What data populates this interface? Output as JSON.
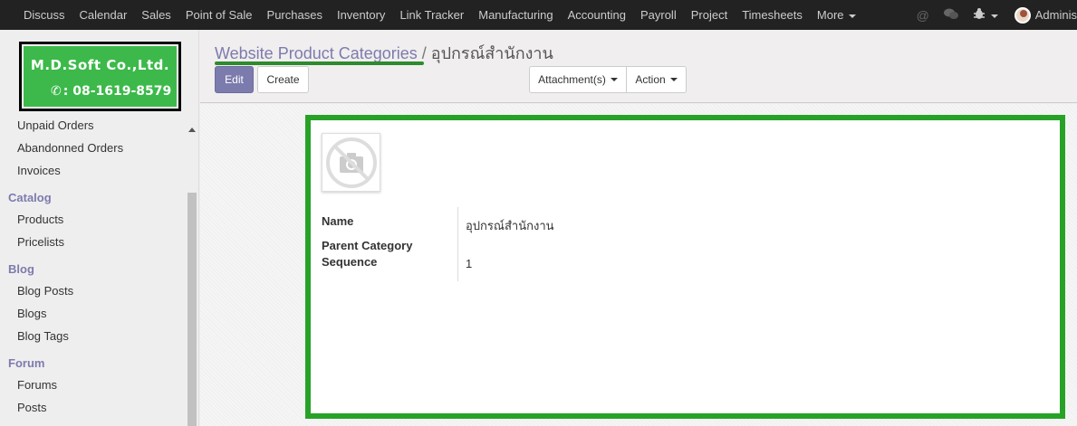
{
  "topbar": {
    "menu": [
      "Discuss",
      "Calendar",
      "Sales",
      "Point of Sale",
      "Purchases",
      "Inventory",
      "Link Tracker",
      "Manufacturing",
      "Accounting",
      "Payroll",
      "Project",
      "Timesheets"
    ],
    "more_label": "More",
    "user_name": "Adminis",
    "icons": [
      "at-icon",
      "chat-icon",
      "bug-icon"
    ]
  },
  "logo": {
    "company": "M.D.Soft Co.,Ltd.",
    "phone": ": 08-1619-8579"
  },
  "sidebar": {
    "items_top": [
      "Unpaid Orders",
      "Abandonned Orders",
      "Invoices"
    ],
    "sections": [
      {
        "title": "Catalog",
        "items": [
          "Products",
          "Pricelists"
        ]
      },
      {
        "title": "Blog",
        "items": [
          "Blog Posts",
          "Blogs",
          "Blog Tags"
        ]
      },
      {
        "title": "Forum",
        "items": [
          "Forums",
          "Posts"
        ]
      }
    ]
  },
  "breadcrumb": {
    "parent": "Website Product Categories",
    "separator": "/",
    "current": "อุปกรณ์สำนักงาน"
  },
  "buttons": {
    "edit": "Edit",
    "create": "Create",
    "attachments": "Attachment(s)",
    "action": "Action"
  },
  "form": {
    "name_label": "Name",
    "name_value": "อุปกรณ์สำนักงาน",
    "parent_label": "Parent Category",
    "parent_value": "",
    "sequence_label": "Sequence",
    "sequence_value": "1"
  },
  "colors": {
    "accent": "#7c7bad",
    "highlight": "#27a227",
    "topbar": "#222222"
  }
}
